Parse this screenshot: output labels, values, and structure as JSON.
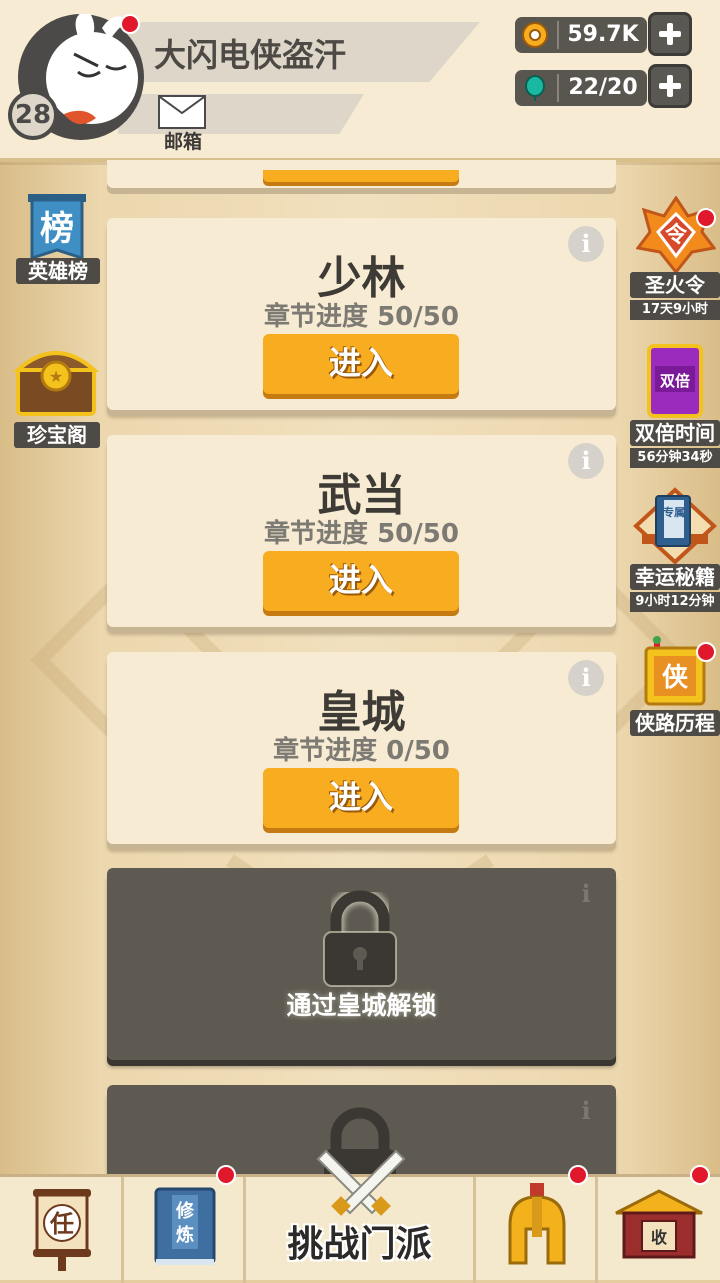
{
  "player": {
    "name": "大闪电侠盗汗",
    "level": "28",
    "mail_label": "邮箱"
  },
  "resources": {
    "gold": "59.7K",
    "gems": "22/20"
  },
  "left_menu": {
    "hero_rank_icon_text": "榜",
    "hero_rank": "英雄榜",
    "treasure": "珍宝阁"
  },
  "right_menu": {
    "sacred_fire": {
      "icon_text": "令",
      "label": "圣火令",
      "timer": "17天9小时"
    },
    "double_time": {
      "icon_text": "双倍",
      "label": "双倍时间",
      "timer": "56分钟34秒"
    },
    "lucky_manual": {
      "icon_text": "专属",
      "label": "幸运秘籍",
      "timer": "9小时12分钟"
    },
    "hero_path": {
      "icon_text": "侠",
      "label": "侠路历程"
    }
  },
  "sects": [
    {
      "name": "少林",
      "progress": "章节进度 50/50",
      "enter": "进入"
    },
    {
      "name": "武当",
      "progress": "章节进度 50/50",
      "enter": "进入"
    },
    {
      "name": "皇城",
      "progress": "章节进度 0/50",
      "enter": "进入"
    }
  ],
  "locked": [
    {
      "text": "通过皇城解锁"
    }
  ],
  "info_symbol": "i",
  "bottom_nav": {
    "task_icon_text": "任",
    "cultivate_icon_text": "修炼",
    "challenge": "挑战门派",
    "shop_icon_text": "收"
  },
  "colors": {
    "accent_orange": "#f8ac1f",
    "card_bg": "#f7ecd3",
    "locked_bg": "#5e5a52",
    "badge_red": "#e1182b"
  }
}
